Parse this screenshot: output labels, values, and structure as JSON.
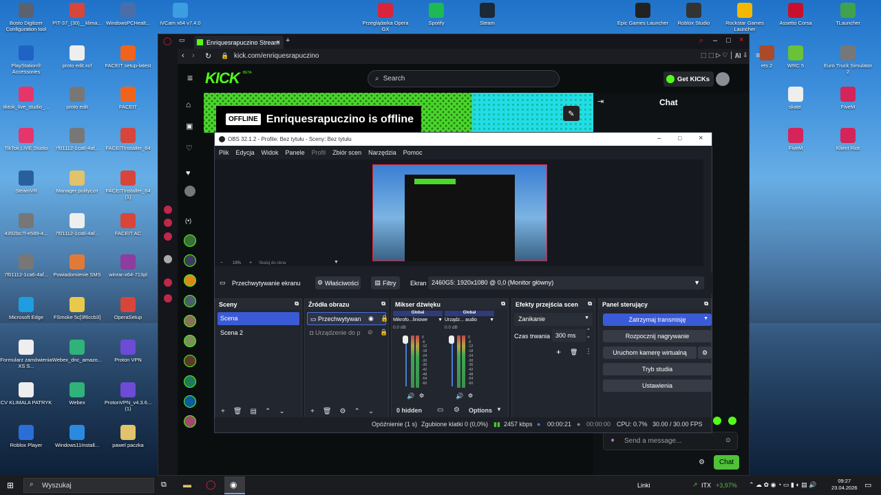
{
  "desktop": {
    "icons": [
      {
        "label": "Bosto Digitizer Configuration tool",
        "color": "#5a6270"
      },
      {
        "label": "PIT-37_(30)__klima...",
        "color": "#d8453b"
      },
      {
        "label": "WindowsPCHealt...",
        "color": "#4b6ea8"
      },
      {
        "label": "iVCam x64 v7.4.0",
        "color": "#3a9ee0"
      },
      {
        "label": "PlayStation® Accessories",
        "color": "#1f63c4"
      },
      {
        "label": "proto edit.xcf",
        "color": "#eeeeee"
      },
      {
        "label": "FACEIT setup-latest",
        "color": "#f1631c"
      },
      {
        "label": "tiktok_live_studio_...",
        "color": "#e6356b"
      },
      {
        "label": "proto edit",
        "color": "#777777"
      },
      {
        "label": "FACEIT",
        "color": "#f1631c"
      },
      {
        "label": "TikTok LIVE Studio",
        "color": "#e6356b"
      },
      {
        "label": "7f01112-1ca6-4af...",
        "color": "#777777"
      },
      {
        "label": "FACEITInstaller_64",
        "color": "#d8453b"
      },
      {
        "label": "SteamVR",
        "color": "#2a5f9e"
      },
      {
        "label": "Manager polityczn",
        "color": "#e0c36a"
      },
      {
        "label": "FACEITInstaller_64 (1)",
        "color": "#d8453b"
      },
      {
        "label": "4392bc7f-e589-4...",
        "color": "#777777"
      },
      {
        "label": "7f01112-1ca6-4af...",
        "color": "#eeeeee"
      },
      {
        "label": "FACEIT AC",
        "color": "#d8453b"
      },
      {
        "label": "7f01112-1ca6-4af...",
        "color": "#777777"
      },
      {
        "label": "Powiadomienie SMS",
        "color": "#e07a3a"
      },
      {
        "label": "winrar-x64-713pl",
        "color": "#8d3ca0"
      },
      {
        "label": "Microsoft Edge",
        "color": "#1e9ee0"
      },
      {
        "label": "FSmoke 5c[3f6ccb3]",
        "color": "#e8c94a"
      },
      {
        "label": "OperaSetup",
        "color": "#d8453b"
      },
      {
        "label": "Formularz zamówienia XS S...",
        "color": "#eeeeee"
      },
      {
        "label": "Webex_dnc_amazo...",
        "color": "#2fb37a"
      },
      {
        "label": "Proton VPN",
        "color": "#6d4bd6"
      },
      {
        "label": "CV KLIMALA PATRYK",
        "color": "#eeeeee"
      },
      {
        "label": "Webex",
        "color": "#2fb37a"
      },
      {
        "label": "ProtonVPN_v4.3.6... (1)",
        "color": "#6d4bd6"
      },
      {
        "label": "Roblox Player",
        "color": "#2b6fd6"
      },
      {
        "label": "Windows11Install...",
        "color": "#2b8ae0"
      },
      {
        "label": "pawel paczka",
        "color": "#e0c36a"
      },
      {
        "label": "Przeglądarka Opera GX",
        "color": "#d8253b"
      },
      {
        "label": "Spotify",
        "color": "#1db954"
      },
      {
        "label": "Steam",
        "color": "#1b2838"
      },
      {
        "label": "Epic Games Launcher",
        "color": "#222222"
      },
      {
        "label": "Roblox Studio",
        "color": "#333333"
      },
      {
        "label": "Rockstar Games Launcher",
        "color": "#f5b800"
      },
      {
        "label": "Assetto Corsa",
        "color": "#c8102e"
      },
      {
        "label": "TLauncher",
        "color": "#3fa34d"
      },
      {
        "label": "ets 2",
        "color": "#aa4a2a"
      },
      {
        "label": "WRC 5",
        "color": "#68c23a"
      },
      {
        "label": "Euro Truck Simulator 2",
        "color": "#777777"
      },
      {
        "label": "skate.",
        "color": "#eeeeee"
      },
      {
        "label": "FiveM",
        "color": "#d4245a"
      },
      {
        "label": "FiveM",
        "color": "#d4245a"
      },
      {
        "label": "Klient Riot",
        "color": "#d4245a"
      }
    ]
  },
  "browser": {
    "tab_title": "Enriquesrapuczino Stream",
    "url": "kick.com/enriquesrapuczino",
    "toolbar_ai": "AI",
    "kick": {
      "logo": "KICK",
      "logo_beta": "BETA",
      "search_placeholder": "Search",
      "get_kicks": "Get KICKs",
      "offline_tag": "OFFLINE",
      "offline_title": "Enriquesrapuczino is offline",
      "chat_title": "Chat",
      "chat_placeholder": "Send a message...",
      "chat_button": "Chat"
    }
  },
  "obs": {
    "title": "OBS 32.1.2 - Profile: Bez tytułu - Sceny: Bez tytułu",
    "menu": [
      "Plik",
      "Edycja",
      "Widok",
      "Panele",
      "Profil",
      "Zbiór scen",
      "Narzędzia",
      "Pomoc"
    ],
    "zoom": "19%",
    "scale_label": "Skaluj do okna",
    "source_toolbar": {
      "source": "Przechwytywanie ekranu",
      "properties": "Właściwości",
      "filters": "Filtry",
      "screen_label": "Ekran",
      "screen_value": "2460G5: 1920x1080 @ 0,0 (Monitor główny)"
    },
    "scenes": {
      "title": "Sceny",
      "items": [
        "Scena",
        "Scena 2"
      ]
    },
    "sources": {
      "title": "Źródła obrazu",
      "items": [
        "Przechwytywan",
        "Urządzenie do p"
      ]
    },
    "mixer": {
      "title": "Mikser dźwięku",
      "channels": [
        {
          "scope": "Global",
          "name": "Mikrofo...liniowe",
          "db": "0.0 dB"
        },
        {
          "scope": "Global",
          "name": "Urządz... audio",
          "db": "0.0 dB"
        }
      ],
      "scale": [
        "0",
        "-6",
        "-12",
        "-18",
        "-24",
        "-30",
        "-36",
        "-42",
        "-48",
        "-54",
        "-60"
      ],
      "hidden": "0 hidden",
      "options": "Options"
    },
    "transitions": {
      "title": "Efekty przejścia scen",
      "value": "Zanikanie",
      "duration_label": "Czas trwania",
      "duration_value": "300 ms"
    },
    "controls": {
      "title": "Panel sterujący",
      "buttons": [
        "Zatrzymaj transmisję",
        "Rozpocznij nagrywanie",
        "Uruchom kamerę wirtualną",
        "Tryb studia",
        "Ustawienia"
      ]
    },
    "status": {
      "delay": "Opóźnienie (1 s)",
      "dropped": "Zgubione klatki 0 (0,0%)",
      "bitrate": "2457 kbps",
      "stream_time": "00:00:21",
      "rec_time": "00:00:00",
      "cpu": "CPU: 0.7%",
      "fps": "30.00 / 30.00 FPS"
    }
  },
  "taskbar": {
    "search_placeholder": "Wyszukaj",
    "links": "Linki",
    "stock": "ITX",
    "stock_change": "+3,97%",
    "time": "09:27",
    "date": "23.04.2026"
  }
}
